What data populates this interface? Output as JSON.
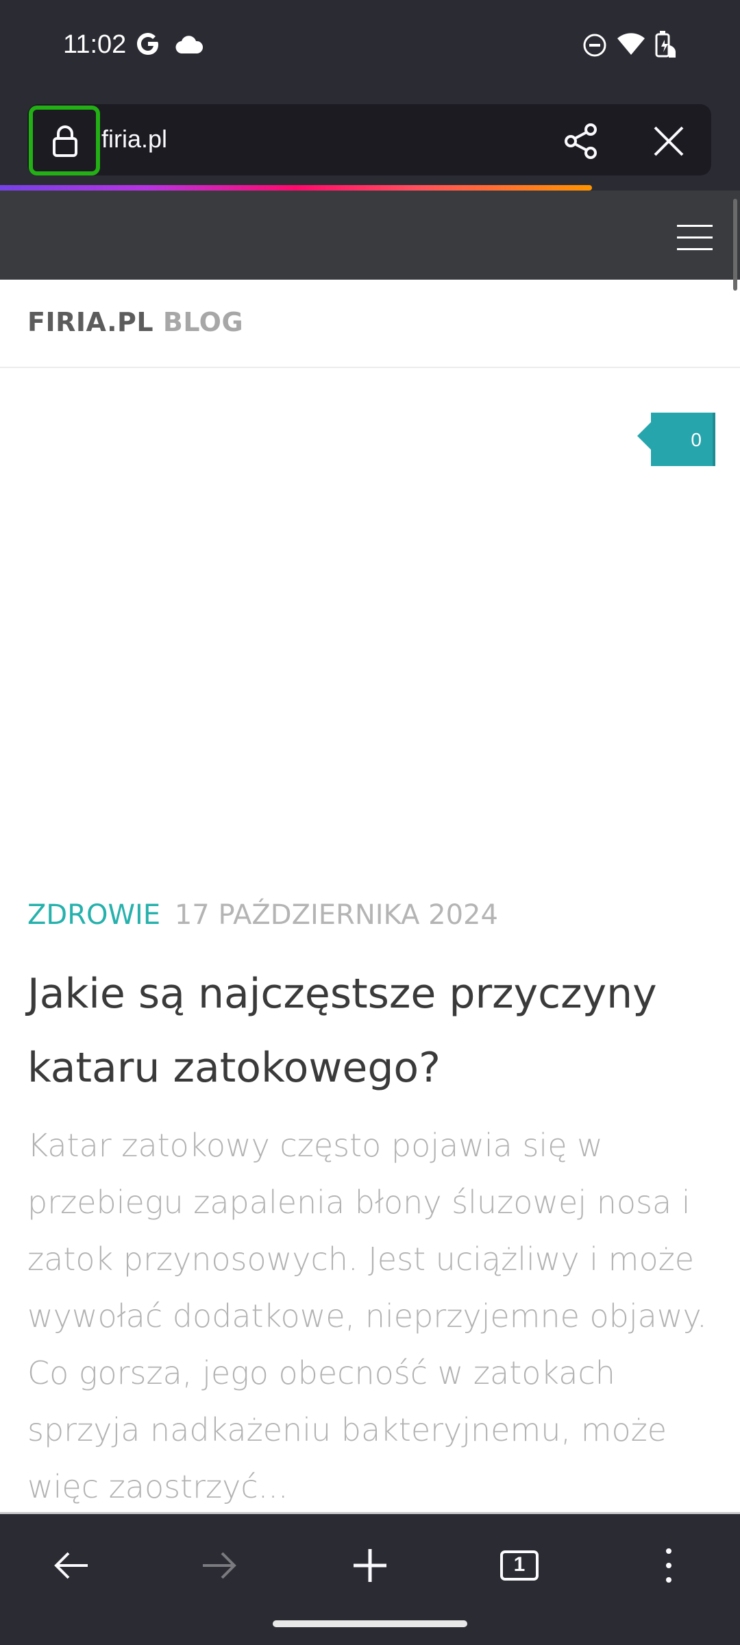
{
  "status_bar": {
    "time": "11:02",
    "icons": [
      "google-icon",
      "cloud-icon",
      "do-not-disturb-icon",
      "wifi-icon",
      "battery-icon"
    ]
  },
  "browser": {
    "url": "firia.pl",
    "load_progress_percent": 80,
    "accent_color": "#22b014"
  },
  "site": {
    "title_primary": "FIRIA.PL",
    "title_secondary": "BLOG",
    "comment_count": "0"
  },
  "article": {
    "category": "ZDROWIE",
    "date": "17 PAŹDZIERNIKA 2024",
    "headline": "Jakie są najczęstsze przyczyny kataru zatokowego?",
    "excerpt": "Katar zatokowy często pojawia się w przebiegu zapalenia błony śluzowej nosa i zatok przynosowych. Jest uciążliwy i może wywołać dodatkowe, nieprzyjemne objawy. Co gorsza, jego obecność w zatokach sprzyja nadkażeniu bakteryjnemu, może więc zaostrzyć..."
  },
  "bottom_nav": {
    "tab_count": "1"
  },
  "colors": {
    "category": "#26b1ac",
    "comment_badge": "#26a5ad",
    "chrome": "#2b2b33"
  }
}
